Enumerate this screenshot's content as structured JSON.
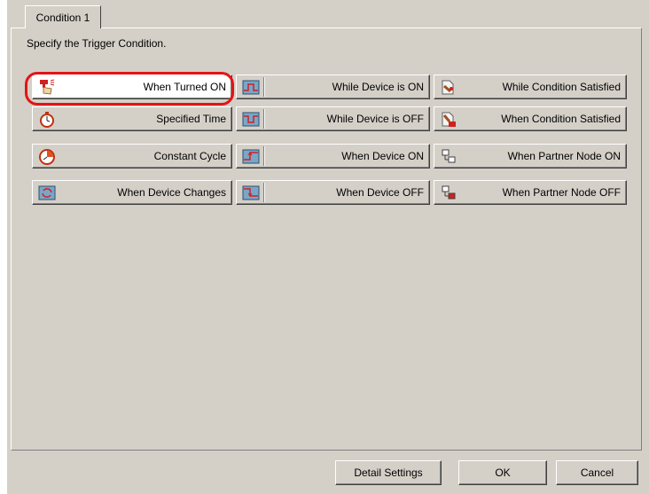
{
  "tab": {
    "label": "Condition 1"
  },
  "instruction": "Specify the Trigger Condition.",
  "buttons": [
    {
      "label": "When Turned ON",
      "icon": "hand-press-icon"
    },
    {
      "label": "While Device is ON",
      "icon": "device-on-graph-icon"
    },
    {
      "label": "While Condition Satisfied",
      "icon": "condition-satisfied-icon"
    },
    {
      "label": "Specified Time",
      "icon": "alarm-clock-icon"
    },
    {
      "label": "While Device is OFF",
      "icon": "device-off-graph-icon"
    },
    {
      "label": "When Condition Satisfied",
      "icon": "condition-ok-icon"
    },
    {
      "label": "Constant Cycle",
      "icon": "clock-cycle-icon"
    },
    {
      "label": "When Device ON",
      "icon": "device-rise-graph-icon"
    },
    {
      "label": "When Partner Node ON",
      "icon": "partner-node-on-icon"
    },
    {
      "label": "When Device Changes",
      "icon": "device-change-graph-icon"
    },
    {
      "label": "When Device OFF",
      "icon": "device-fall-graph-icon"
    },
    {
      "label": "When Partner Node OFF",
      "icon": "partner-node-off-icon"
    }
  ],
  "footer": {
    "detail_label": "Detail Settings",
    "ok_label": "OK",
    "cancel_label": "Cancel"
  },
  "colors": {
    "highlight": "#e31414",
    "face": "#d4d0c8"
  }
}
